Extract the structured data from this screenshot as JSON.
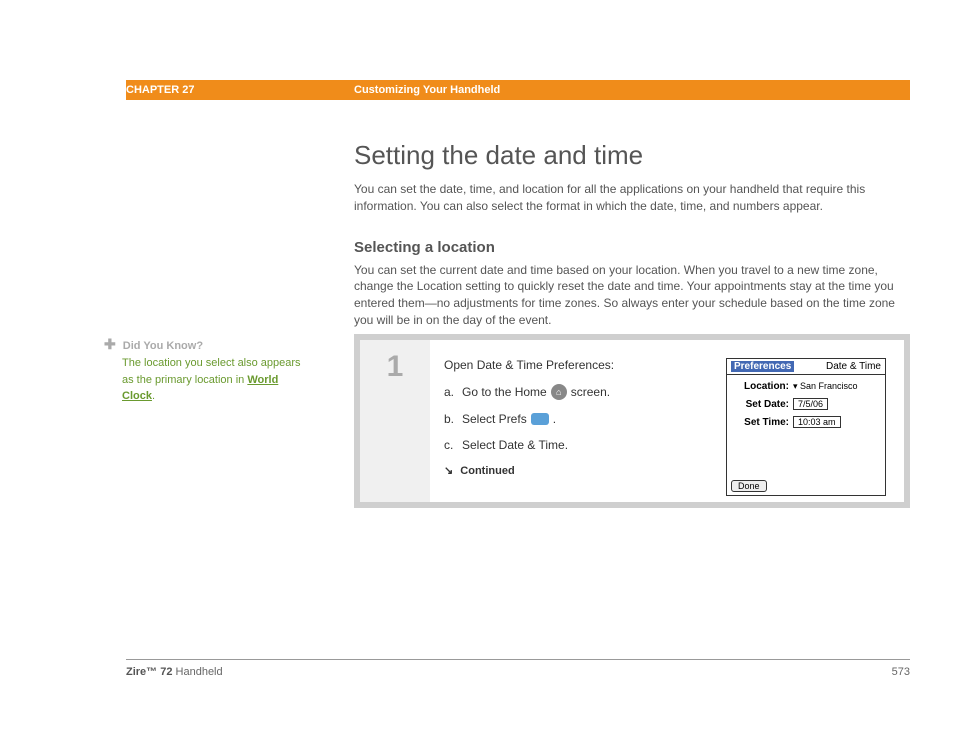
{
  "header": {
    "chapter": "CHAPTER 27",
    "title": "Customizing Your Handheld"
  },
  "main": {
    "h1": "Setting the date and time",
    "intro": "You can set the date, time, and location for all the applications on your handheld that require this information. You can also select the format in which the date, time, and numbers appear.",
    "h2": "Selecting a location",
    "sub": "You can set the current date and time based on your location. When you travel to a new time zone, change the Location setting to quickly reset the date and time. Your appointments stay at the time you entered them—no adjustments for time zones. So always enter your schedule based on the time zone you will be in on the day of the event."
  },
  "tip": {
    "header": "Did You Know?",
    "body_pre": "The location you select also appears as the primary location in ",
    "link": "World Clock",
    "body_post": "."
  },
  "step": {
    "number": "1",
    "title": "Open Date & Time Preferences:",
    "a_pre": "Go to the Home ",
    "a_post": " screen.",
    "b_pre": "Select Prefs ",
    "b_post": ".",
    "c": "Select Date & Time.",
    "continued": "Continued"
  },
  "device": {
    "header_left": "Preferences",
    "header_right": "Date & Time",
    "location_label": "Location:",
    "location_value": "San Francisco",
    "date_label": "Set Date:",
    "date_value": "7/5/06",
    "time_label": "Set Time:",
    "time_value": "10:03 am",
    "done": "Done"
  },
  "footer": {
    "product_bold": "Zire™ 72",
    "product_rest": " Handheld",
    "page": "573"
  }
}
